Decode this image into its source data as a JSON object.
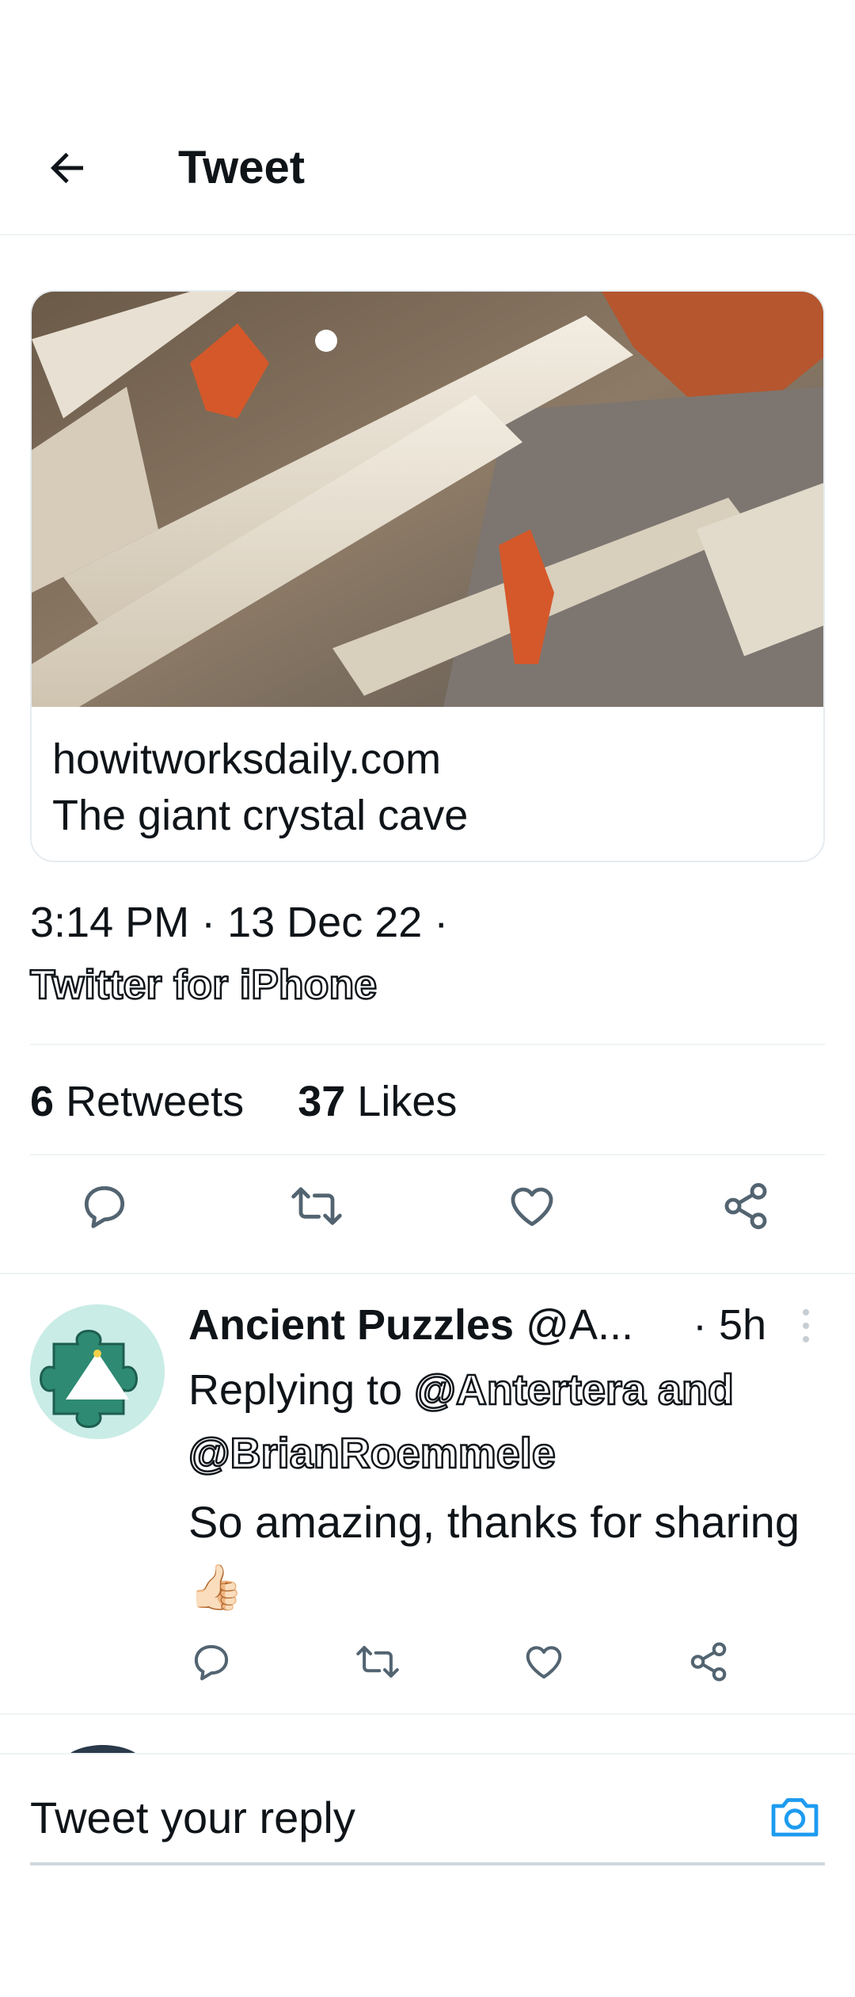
{
  "header": {
    "title": "Tweet",
    "back_icon": "arrow-left-icon"
  },
  "link_card": {
    "domain": "howitworksdaily.com",
    "title": "The giant crystal cave"
  },
  "tweet_meta": {
    "time_line": "3:14 PM · 13 Dec 22 ·",
    "source": "Twitter for iPhone"
  },
  "stats": {
    "retweets_count": "6",
    "retweets_label": "Retweets",
    "likes_count": "37",
    "likes_label": "Likes"
  },
  "reply": {
    "name": "Ancient Puzzles",
    "handle": "@A...",
    "time": "· 5h",
    "replying_prefix": "Replying to",
    "replying_users": "@Antertera and @BrianRoemmele",
    "text": "So amazing, thanks for sharing",
    "emoji": "👍🏻"
  },
  "composer": {
    "placeholder": "Tweet your reply"
  },
  "colors": {
    "accent": "#1d9bf0",
    "icon_gray": "#536471",
    "text": "#0f1419"
  }
}
